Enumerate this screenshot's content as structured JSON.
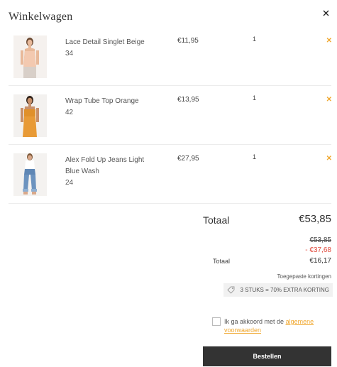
{
  "header": {
    "title": "Winkelwagen"
  },
  "cart": {
    "items": [
      {
        "name": "Lace Detail Singlet Beige",
        "size": "34",
        "price": "€11,95",
        "quantity": "1",
        "remove_icon": "close-icon",
        "product_colors": {
          "top": "#f3c9b0",
          "skin": "#e8b99a"
        }
      },
      {
        "name": "Wrap Tube Top Orange",
        "size": "42",
        "price": "€13,95",
        "quantity": "1",
        "remove_icon": "close-icon",
        "product_colors": {
          "top": "#e0902a",
          "skin": "#c8906a"
        }
      },
      {
        "name": "Alex Fold Up Jeans Light Blue Wash",
        "size": "24",
        "price": "€27,95",
        "quantity": "1",
        "remove_icon": "close-icon",
        "product_colors": {
          "top": "#5f87b5",
          "skin": "#d9a88a"
        }
      }
    ]
  },
  "summary": {
    "total_label": "Totaal",
    "total_value": "€53,85",
    "old_price": "€53,85",
    "discount": "- €37,68",
    "final_label": "Totaal",
    "final_value": "€16,17",
    "applied_label": "Toegepaste kortingen",
    "discount_badge": "3 STUKS = 70% EXTRA KORTING",
    "discount_icon": "tag-icon"
  },
  "agreement": {
    "text": "Ik ga akkoord met de",
    "link": "algemene voorwaarden",
    "checked": false
  },
  "order_button": {
    "label": "Bestellen"
  },
  "colors": {
    "accent": "#f0a830",
    "discount": "#e04a3c",
    "button": "#333333"
  }
}
